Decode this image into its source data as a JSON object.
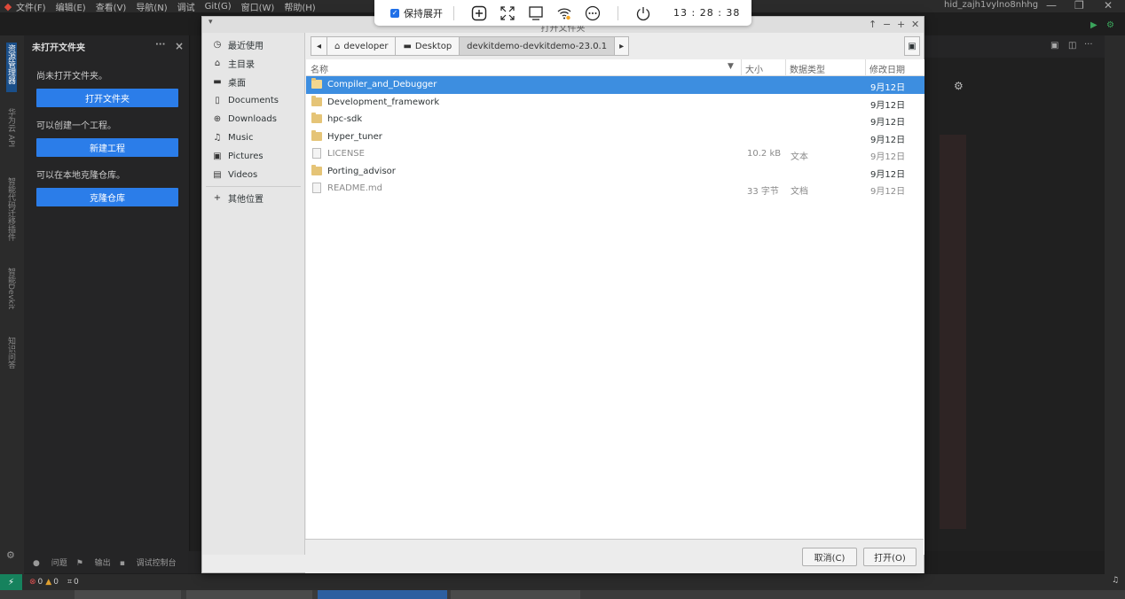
{
  "menubar": {
    "items": [
      "文件(F)",
      "编辑(E)",
      "查看(V)",
      "导航(N)",
      "调试",
      "Git(G)",
      "窗口(W)",
      "帮助(H)"
    ],
    "host": "hid_zajh1vylno8nhhg"
  },
  "remotebar": {
    "keep_open_label": "保持展开",
    "time": "13 : 28 : 38"
  },
  "activity": {
    "tabs": [
      "资源管理器",
      "华为云 API",
      "智能代码迁移插件",
      "智能Devkit",
      "知识问答"
    ]
  },
  "sidebar": {
    "title": "未打开文件夹",
    "no_folder_text": "尚未打开文件夹。",
    "open_folder_button": "打开文件夹",
    "create_project_text": "可以创建一个工程。",
    "new_project_button": "新建工程",
    "clone_text": "可以在本地克隆仓库。",
    "clone_button": "克隆仓库"
  },
  "panel": {
    "tabs": [
      "问题",
      "输出",
      "调试控制台"
    ]
  },
  "status": {
    "errors": "0",
    "warnings": "0",
    "ports": "0"
  },
  "dialog": {
    "title": "打开文件夹",
    "places": [
      {
        "icon": "clock-icon",
        "glyph": "◷",
        "label": "最近使用"
      },
      {
        "icon": "home-icon",
        "glyph": "⌂",
        "label": "主目录"
      },
      {
        "icon": "desktop-icon",
        "glyph": "▬",
        "label": "桌面"
      },
      {
        "icon": "document-icon",
        "glyph": "▯",
        "label": "Documents"
      },
      {
        "icon": "download-icon",
        "glyph": "⊕",
        "label": "Downloads"
      },
      {
        "icon": "music-icon",
        "glyph": "♫",
        "label": "Music"
      },
      {
        "icon": "pictures-icon",
        "glyph": "▣",
        "label": "Pictures"
      },
      {
        "icon": "videos-icon",
        "glyph": "▤",
        "label": "Videos"
      }
    ],
    "other_locations": "其他位置",
    "path": [
      "developer",
      "Desktop",
      "devkitdemo-devkitdemo-23.0.1"
    ],
    "columns": {
      "name": "名称",
      "size": "大小",
      "type": "数据类型",
      "modified": "修改日期"
    },
    "files": [
      {
        "name": "Compiler_and_Debugger",
        "kind": "folder",
        "size": "",
        "type": "",
        "date": "9月12日",
        "selected": true
      },
      {
        "name": "Development_framework",
        "kind": "folder",
        "size": "",
        "type": "",
        "date": "9月12日"
      },
      {
        "name": "hpc-sdk",
        "kind": "folder",
        "size": "",
        "type": "",
        "date": "9月12日"
      },
      {
        "name": "Hyper_tuner",
        "kind": "folder",
        "size": "",
        "type": "",
        "date": "9月12日"
      },
      {
        "name": "LICENSE",
        "kind": "file",
        "size": "10.2 kB",
        "type": "文本",
        "date": "9月12日"
      },
      {
        "name": "Porting_advisor",
        "kind": "folder",
        "size": "",
        "type": "",
        "date": "9月12日"
      },
      {
        "name": "README.md",
        "kind": "file",
        "size": "33 字节",
        "type": "文档",
        "date": "9月12日"
      }
    ],
    "cancel_button": "取消(C)",
    "open_button": "打开(O)"
  }
}
